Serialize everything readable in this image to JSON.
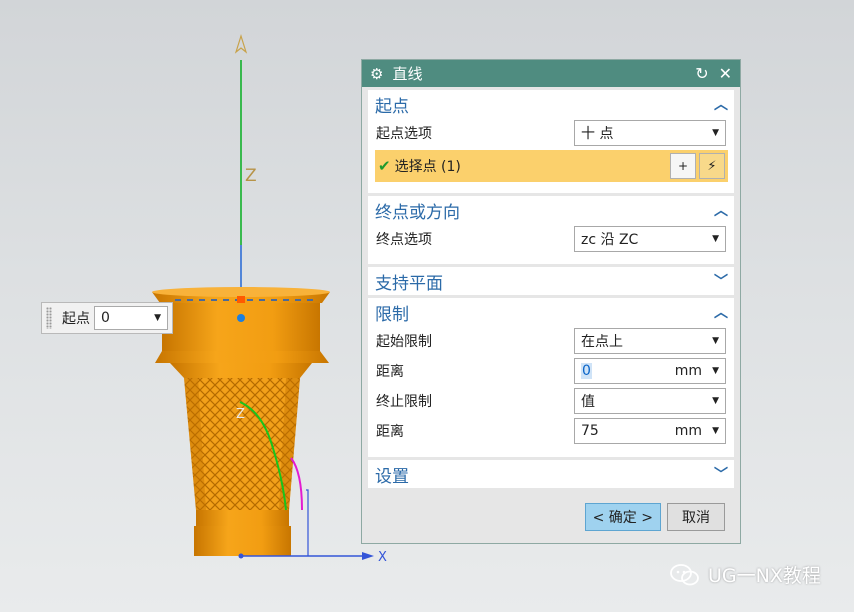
{
  "viewport": {
    "axis_z": "Z",
    "axis_x": "X"
  },
  "float_widget": {
    "label": "起点",
    "value": "0"
  },
  "dialog": {
    "title": "直线",
    "sections": {
      "start": {
        "title": "起点",
        "option_label": "起点选项",
        "option_value": "十 点",
        "select_point": "选择点 (1)"
      },
      "end": {
        "title": "终点或方向",
        "option_label": "终点选项",
        "option_value": "zc 沿 ZC"
      },
      "support": {
        "title": "支持平面"
      },
      "limits": {
        "title": "限制",
        "start_limit_label": "起始限制",
        "start_limit_value": "在点上",
        "distance1_label": "距离",
        "distance1_value": "0",
        "distance1_unit": "mm",
        "end_limit_label": "终止限制",
        "end_limit_value": "值",
        "distance2_label": "距离",
        "distance2_value": "75",
        "distance2_unit": "mm"
      },
      "settings": {
        "title": "设置"
      }
    },
    "ok_label": "< 确定 >",
    "cancel_label": "取消"
  },
  "watermark": "UG一NX教程",
  "colors": {
    "titlebar": "#4f8c80",
    "section_title": "#2b6aa8",
    "selected_row": "#fbd06c",
    "ok_button": "#9fd2ef",
    "part": "#f29d12"
  }
}
